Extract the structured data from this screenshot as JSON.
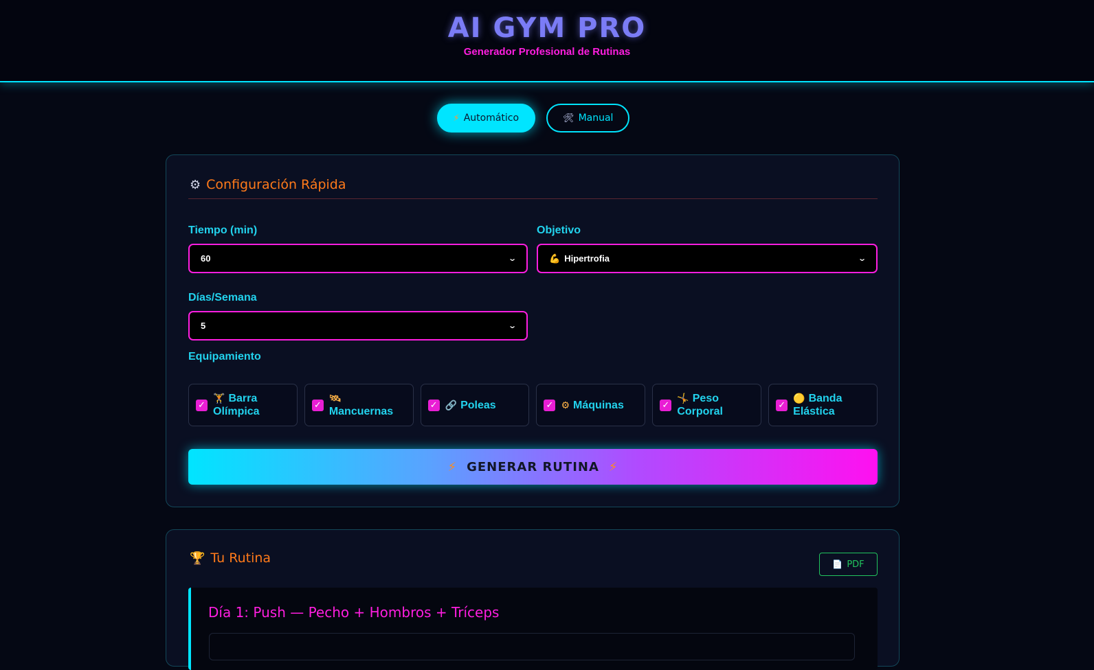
{
  "header": {
    "title": "AI GYM PRO",
    "subtitle": "Generador Profesional de Rutinas"
  },
  "mode_switch": {
    "automatic": {
      "icon": "lightning-icon",
      "glyph": "⚡",
      "label": "Automático",
      "active": true
    },
    "manual": {
      "icon": "tools-icon",
      "glyph": "🛠",
      "label": "Manual",
      "active": false
    }
  },
  "config": {
    "title": "Configuración Rápida",
    "title_icon": "gear-icon",
    "title_glyph": "⚙",
    "time": {
      "label": "Tiempo (min)",
      "value": "60"
    },
    "goal": {
      "label": "Objetivo",
      "value": "Hipertrofia",
      "icon": "flexed-biceps-icon",
      "glyph": "💪"
    },
    "days": {
      "label": "Días/Semana",
      "value": "5"
    },
    "equipment": {
      "label": "Equipamiento",
      "items": [
        {
          "label": "Barra Olímpica",
          "icon": "weightlifter-icon",
          "glyph": "🏋",
          "checked": true
        },
        {
          "label": "Mancuernas",
          "icon": "satellite-icon",
          "glyph": "🛰",
          "checked": true
        },
        {
          "label": "Poleas",
          "icon": "link-icon",
          "glyph": "🔗",
          "checked": true
        },
        {
          "label": "Máquinas",
          "icon": "gear-icon",
          "glyph": "⚙",
          "checked": true
        },
        {
          "label": "Peso Corporal",
          "icon": "cartwheel-icon",
          "glyph": "🤸",
          "checked": true
        },
        {
          "label": "Banda Elástica",
          "icon": "yellow-circle-icon",
          "glyph": "🟡",
          "checked": true
        }
      ]
    },
    "generate_button": {
      "label": "GENERAR RUTINA",
      "glyph": "⚡"
    }
  },
  "routine": {
    "title": "Tu Rutina",
    "title_icon": "trophy-icon",
    "title_glyph": "🏆",
    "pdf_button": {
      "label": "PDF",
      "icon": "document-icon",
      "glyph": "📄"
    },
    "days": [
      {
        "title": "Día 1: Push — Pecho + Hombros + Tríceps"
      }
    ]
  },
  "colors": {
    "accent_cyan": "#00e5ff",
    "accent_magenta": "#ff1ee0",
    "accent_orange": "#ff7a1a",
    "pdf_green": "#22c55e",
    "background": "#050814"
  }
}
